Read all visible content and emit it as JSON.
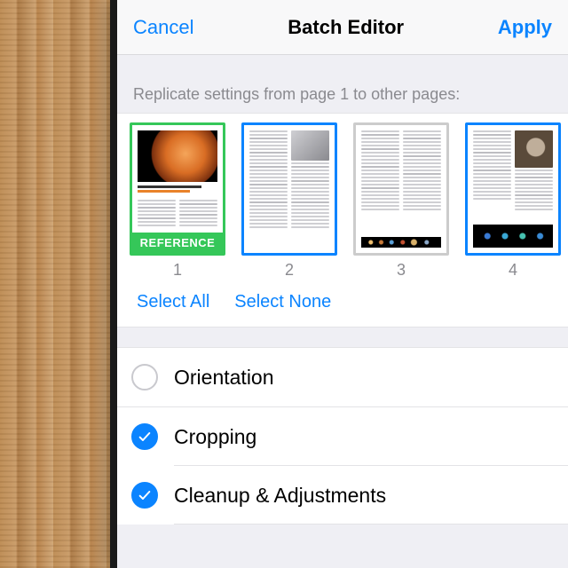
{
  "navbar": {
    "cancel": "Cancel",
    "title": "Batch Editor",
    "apply": "Apply"
  },
  "caption": "Replicate settings from page 1 to other pages:",
  "pages": {
    "reference_badge": "REFERENCE",
    "items": [
      {
        "number": "1",
        "role": "reference",
        "selected": true
      },
      {
        "number": "2",
        "role": "page",
        "selected": true
      },
      {
        "number": "3",
        "role": "page",
        "selected": false
      },
      {
        "number": "4",
        "role": "page",
        "selected": true
      }
    ]
  },
  "selection": {
    "select_all": "Select All",
    "select_none": "Select None"
  },
  "options": [
    {
      "key": "orientation",
      "label": "Orientation",
      "checked": false
    },
    {
      "key": "cropping",
      "label": "Cropping",
      "checked": true
    },
    {
      "key": "cleanup",
      "label": "Cleanup & Adjustments",
      "checked": true
    }
  ],
  "colors": {
    "tint": "#0b84ff",
    "reference": "#35c759"
  }
}
